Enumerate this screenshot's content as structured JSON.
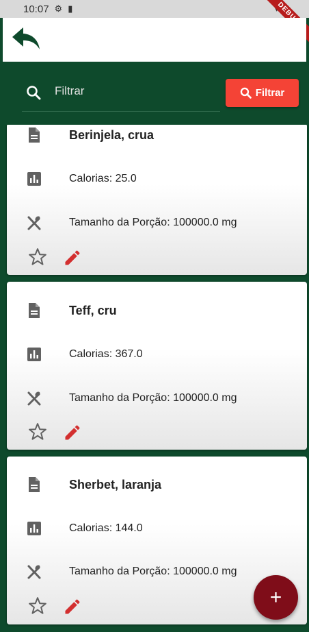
{
  "status_bar": {
    "time": "10:07",
    "debug_label": "DEBUG"
  },
  "filter": {
    "placeholder": "Filtrar",
    "button_label": "Filtrar"
  },
  "foods": [
    {
      "name": "Berinjela, crua",
      "calories": "Calorias: 25.0",
      "portion": "Tamanho da Porção: 100000.0 mg"
    },
    {
      "name": "Teff, cru",
      "calories": "Calorias: 367.0",
      "portion": "Tamanho da Porção: 100000.0 mg"
    },
    {
      "name": "Sherbet, laranja",
      "calories": "Calorias: 144.0",
      "portion": "Tamanho da Porção: 100000.0 mg"
    }
  ],
  "icons": {
    "back": "back-arrow-icon",
    "search": "search-icon",
    "name": "document-icon",
    "calories": "bar-chart-icon",
    "portion": "fork-knife-icon",
    "favorite": "star-outline-icon",
    "edit": "pencil-icon",
    "add": "plus-icon"
  },
  "colors": {
    "primary": "#0e4a2c",
    "filter_button": "#f44336",
    "edit_icon": "#d32f2f",
    "fab": "#7f0d19"
  },
  "fab_label": "+"
}
